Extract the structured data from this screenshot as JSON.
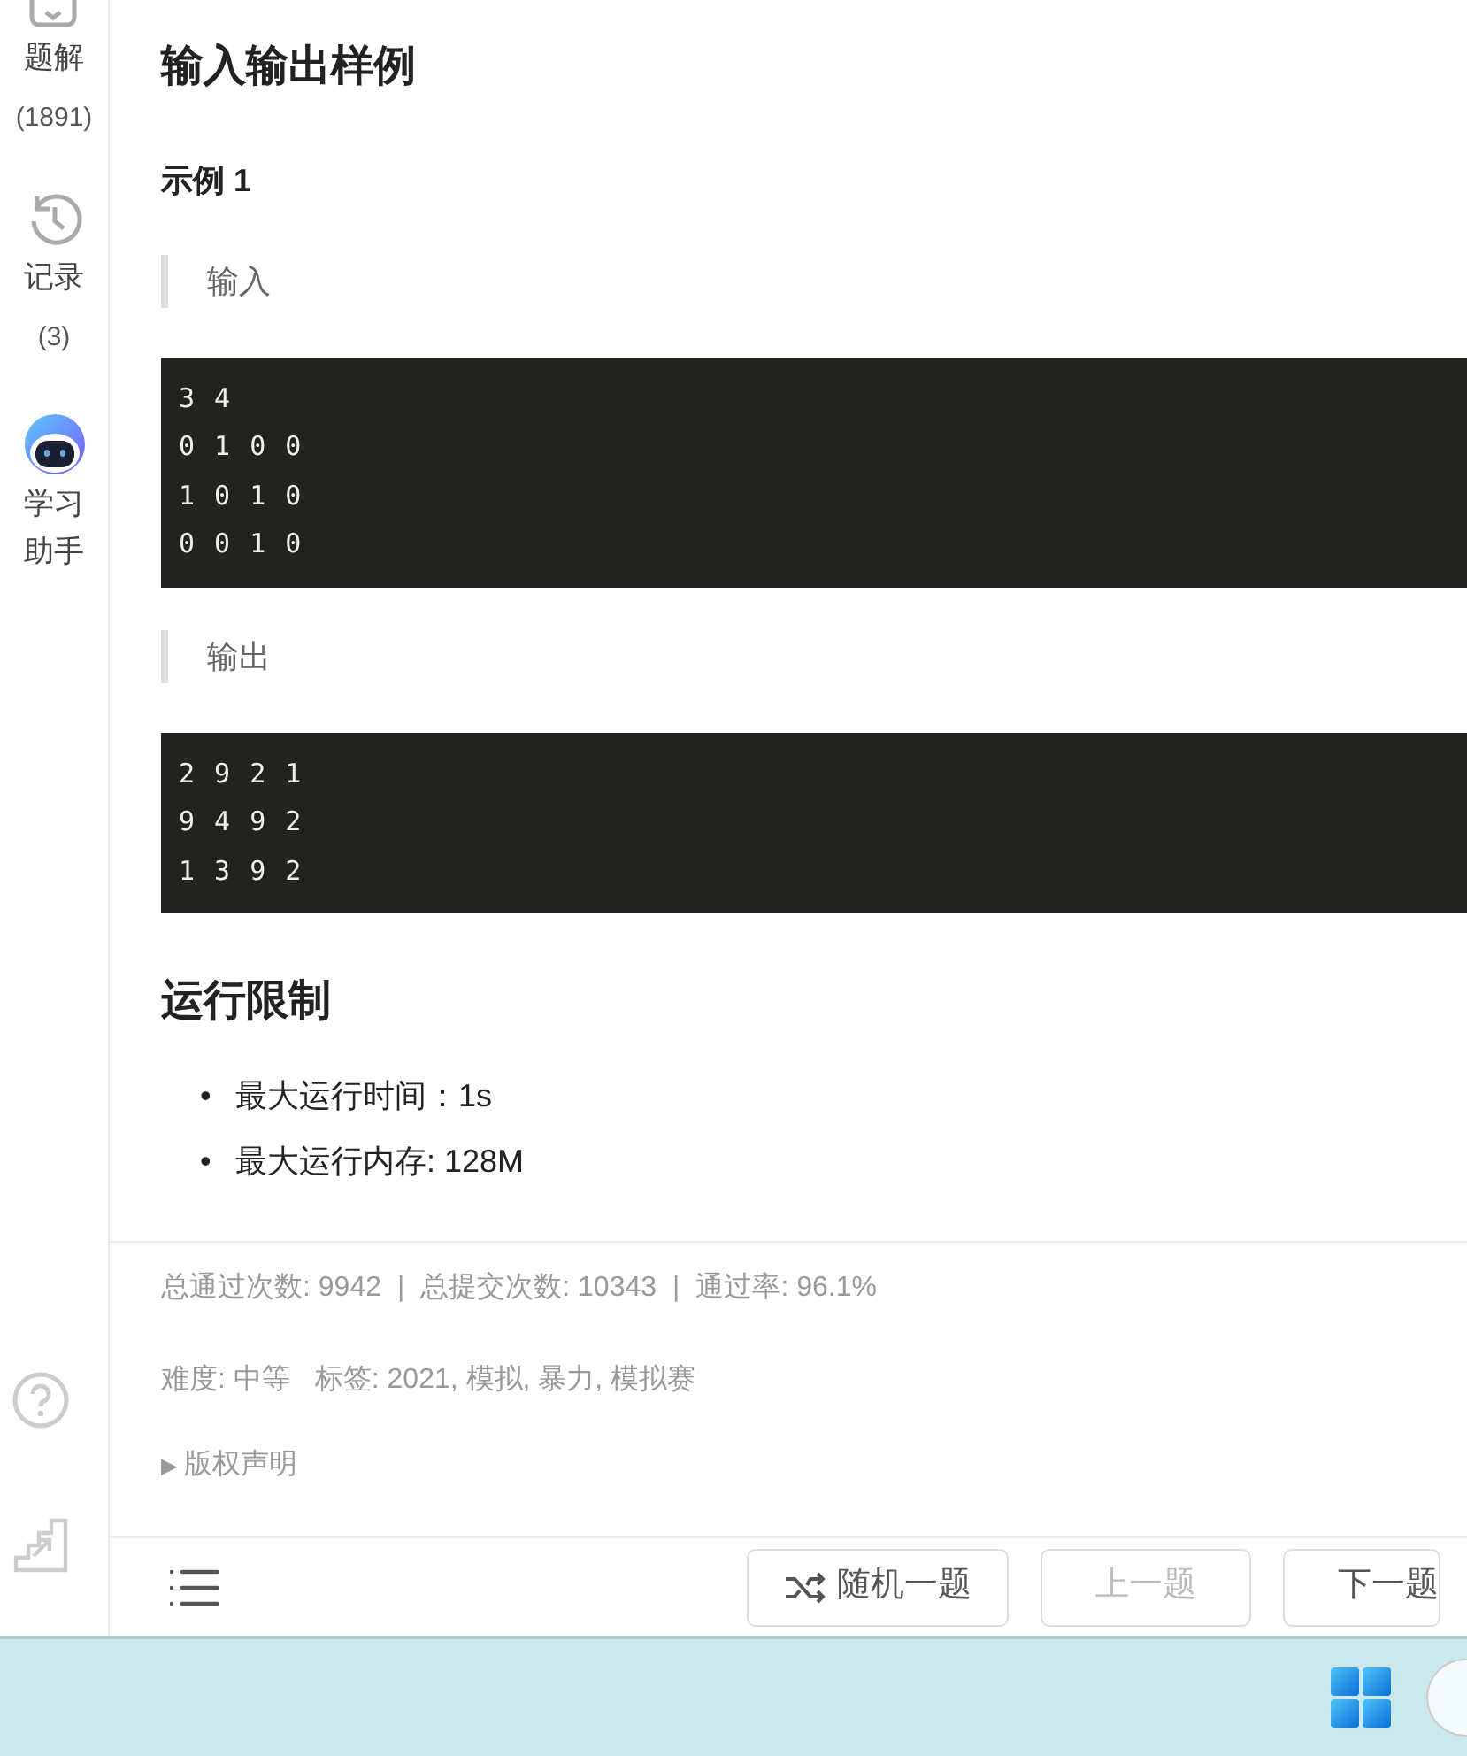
{
  "sidebar": {
    "items": [
      {
        "kind": "solutions",
        "label": "题解",
        "count": "(1891)"
      },
      {
        "kind": "history",
        "label": "记录",
        "count": "(3)"
      },
      {
        "kind": "assistant",
        "label": "学习助手"
      }
    ],
    "bottom_icons": [
      {
        "kind": "help"
      },
      {
        "kind": "ranking"
      }
    ]
  },
  "sections": [
    {
      "title": "输入输出样例",
      "examples": [
        {
          "title": "示例 1",
          "input_label": "输入",
          "input": [
            "3 4",
            "0 1 0 0",
            "1 0 1 0",
            "0 0 1 0"
          ],
          "output_label": "输出",
          "output": [
            "2 9 2 1",
            "9 4 9 2",
            "1 3 9 2"
          ]
        }
      ]
    },
    {
      "title": "运行限制",
      "items": [
        {
          "bullet": "•",
          "text": "最大运行时间：1s"
        },
        {
          "bullet": "•",
          "text": "最大运行内存: 128M"
        }
      ]
    }
  ],
  "stats": [
    {
      "text": "总通过次数: 9942"
    },
    {
      "separator": "|",
      "text": "总提交次数: 10343"
    },
    {
      "separator": "|",
      "text": "通过率: 96.1%"
    }
  ],
  "meta": {
    "difficulty": "难度: 中等",
    "tags": "标签: 2021, 模拟, 暴力, 模拟赛"
  },
  "copyright": {
    "marker": "▶",
    "label": "版权声明",
    "expanded": false
  },
  "footer": {
    "buttons": [
      {
        "kind": "random",
        "label": "随机一题",
        "disabled": false
      },
      {
        "kind": "prev",
        "label": "上一题",
        "disabled": true
      },
      {
        "kind": "next",
        "label": "下一题",
        "disabled": false
      }
    ]
  }
}
